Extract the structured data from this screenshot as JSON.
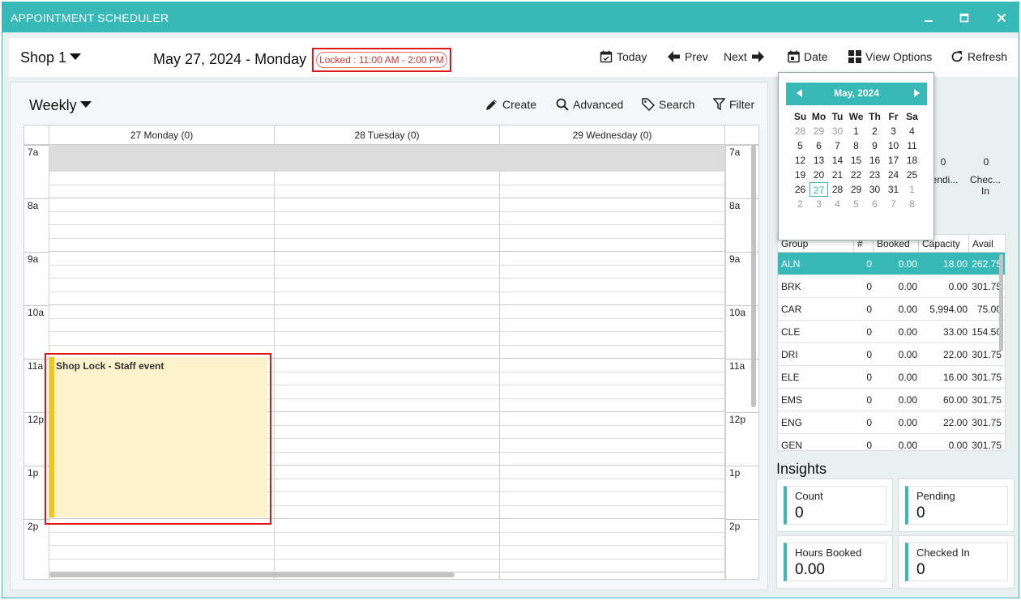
{
  "window": {
    "title": "APPOINTMENT SCHEDULER",
    "minimize": "▁",
    "maximize": "▢",
    "close": "✕"
  },
  "toolbar": {
    "shop": "Shop 1",
    "current_date": "May 27, 2024 - Monday",
    "lock_badge": "Locked : 11:00 AM - 2:00 PM",
    "today": "Today",
    "prev": "Prev",
    "next": "Next",
    "date": "Date",
    "view_options": "View Options",
    "refresh": "Refresh"
  },
  "calendar": {
    "view": "Weekly",
    "create": "Create",
    "advanced": "Advanced",
    "search": "Search",
    "filter": "Filter",
    "days": [
      "27 Monday (0)",
      "28 Tuesday (0)",
      "29 Wednesday (0)"
    ],
    "hours": [
      "7a",
      "8a",
      "9a",
      "10a",
      "11a",
      "12p",
      "1p",
      "2p"
    ],
    "event": {
      "title": "Shop Lock - Staff event",
      "color": "#f5c60c",
      "background": "#fcf3cc"
    }
  },
  "mini_calendar": {
    "month": "May, 2024",
    "weekdays": [
      "Su",
      "Mo",
      "Tu",
      "We",
      "Th",
      "Fr",
      "Sa"
    ],
    "weeks": [
      [
        "28",
        "29",
        "30",
        "1",
        "2",
        "3",
        "4"
      ],
      [
        "5",
        "6",
        "7",
        "8",
        "9",
        "10",
        "11"
      ],
      [
        "12",
        "13",
        "14",
        "15",
        "16",
        "17",
        "18"
      ],
      [
        "19",
        "20",
        "21",
        "22",
        "23",
        "24",
        "25"
      ],
      [
        "26",
        "27",
        "28",
        "29",
        "30",
        "31",
        "1"
      ],
      [
        "2",
        "3",
        "4",
        "5",
        "6",
        "7",
        "8"
      ]
    ],
    "selected": "27"
  },
  "partial_stats": {
    "pending_value": "0",
    "pending_label": "endi...",
    "checked_in_value": "0",
    "checked_in_label": "Chec... In"
  },
  "groups": {
    "headers": [
      "Group",
      "#",
      "Booked",
      "Capacity",
      "Avail"
    ],
    "rows": [
      {
        "group": "ALN",
        "count": "0",
        "booked": "0.00",
        "capacity": "18.00",
        "avail": "262.75"
      },
      {
        "group": "BRK",
        "count": "0",
        "booked": "0.00",
        "capacity": "0.00",
        "avail": "301.75"
      },
      {
        "group": "CAR",
        "count": "0",
        "booked": "0.00",
        "capacity": "5,994.00",
        "avail": "75.00"
      },
      {
        "group": "CLE",
        "count": "0",
        "booked": "0.00",
        "capacity": "33.00",
        "avail": "154.50"
      },
      {
        "group": "DRI",
        "count": "0",
        "booked": "0.00",
        "capacity": "22.00",
        "avail": "301.75"
      },
      {
        "group": "ELE",
        "count": "0",
        "booked": "0.00",
        "capacity": "16.00",
        "avail": "301.75"
      },
      {
        "group": "EMS",
        "count": "0",
        "booked": "0.00",
        "capacity": "60.00",
        "avail": "301.75"
      },
      {
        "group": "ENG",
        "count": "0",
        "booked": "0.00",
        "capacity": "22.00",
        "avail": "301.75"
      },
      {
        "group": "GEN",
        "count": "0",
        "booked": "0.00",
        "capacity": "0.00",
        "avail": "301.75"
      }
    ]
  },
  "insights": {
    "title": "Insights",
    "count_label": "Count",
    "count_value": "0",
    "pending_label": "Pending",
    "pending_value": "0",
    "hours_label": "Hours Booked",
    "hours_value": "0.00",
    "checked_label": "Checked In",
    "checked_value": "0"
  },
  "colors": {
    "accent": "#37b9b7",
    "lock_red": "#e01818"
  }
}
